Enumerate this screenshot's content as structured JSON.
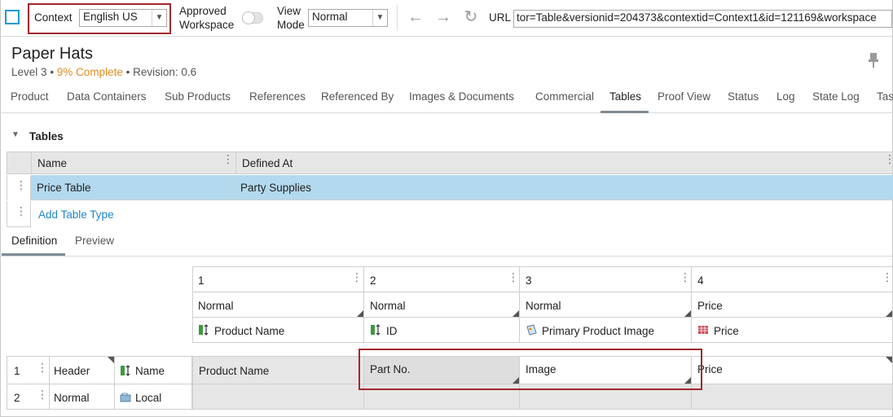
{
  "toolbar": {
    "context_label": "Context",
    "context_value": "English US",
    "approved_label_1": "Approved",
    "approved_label_2": "Workspace",
    "viewmode_label_1": "View",
    "viewmode_label_2": "Mode",
    "viewmode_value": "Normal",
    "url_label": "URL",
    "url_value": "tor=Table&versionid=204373&contextid=Context1&id=121169&workspace"
  },
  "header": {
    "title": "Paper Hats",
    "level": "Level 3",
    "complete": "9% Complete",
    "revision": "Revision: 0.6"
  },
  "tabs": [
    "Product",
    "Data Containers",
    "Sub Products",
    "References",
    "Referenced By",
    "Images & Documents",
    "Commercial",
    "Tables",
    "Proof View",
    "Status",
    "Log",
    "State Log",
    "Tas"
  ],
  "section": {
    "title": "Tables"
  },
  "tables_grid": {
    "col_name": "Name",
    "col_defined": "Defined At",
    "row_name": "Price Table",
    "row_defined": "Party Supplies",
    "add_link": "Add Table Type"
  },
  "subtabs": [
    "Definition",
    "Preview"
  ],
  "definition": {
    "columns": [
      {
        "num": "1",
        "type": "Normal",
        "attr": "Product Name",
        "header": "Product Name"
      },
      {
        "num": "2",
        "type": "Normal",
        "attr": "ID",
        "header": "Part No."
      },
      {
        "num": "3",
        "type": "Normal",
        "attr": "Primary Product Image",
        "header": "Image"
      },
      {
        "num": "4",
        "type": "Price",
        "attr": "Price",
        "header": "Price"
      }
    ],
    "rows": [
      {
        "num": "1",
        "type": "Header",
        "source": "Name"
      },
      {
        "num": "2",
        "type": "Normal",
        "source": "Local"
      }
    ]
  }
}
